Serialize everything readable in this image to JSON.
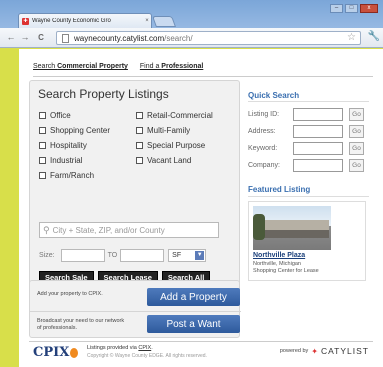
{
  "browser": {
    "tab_title": "Wayne County Economic Gro",
    "tab_close": "×",
    "url_domain": "waynecounty.catylist.com",
    "url_path": "/search/",
    "back_glyph": "←",
    "forward_glyph": "→",
    "reload_glyph": "C",
    "star_glyph": "☆",
    "menu_glyph": "🔧",
    "win_min": "–",
    "win_max": "□",
    "win_close": "x"
  },
  "topnav": {
    "link1_prefix": "Search ",
    "link1_bold": "Commercial Property",
    "link2_prefix": "Find a ",
    "link2_bold": "Professional"
  },
  "search_panel": {
    "title": "Search Property Listings",
    "checkboxes": [
      "Office",
      "Retail-Commercial",
      "Shopping Center",
      "Multi-Family",
      "Hospitality",
      "Special Purpose",
      "Industrial",
      "Vacant Land",
      "Farm/Ranch"
    ],
    "location_placeholder": "City + State, ZIP, and/or County",
    "size_label": "Size:",
    "size_to": "TO",
    "size_unit": "SF",
    "buttons": [
      "Search Sale",
      "Search Lease",
      "Search All"
    ]
  },
  "cta": {
    "add_text": "Add your property to CPIX.",
    "add_button": "Add a Property",
    "want_text": "Broadcast your need to our network of professionals.",
    "want_button": "Post a Want"
  },
  "quick_search": {
    "title": "Quick Search",
    "fields": [
      {
        "label": "Listing ID:",
        "go": "Go"
      },
      {
        "label": "Address:",
        "go": "Go"
      },
      {
        "label": "Keyword:",
        "go": "Go"
      },
      {
        "label": "Company:",
        "go": "Go"
      }
    ]
  },
  "featured": {
    "title": "Featured Listing",
    "name": "Northville Plaza",
    "location": "Northville, Michigan",
    "type": "Shopping Center for Lease"
  },
  "footer": {
    "logo": "CPIX",
    "line1_prefix": "Listings provided via ",
    "line1_link": "CPIX",
    "line1_suffix": ".",
    "line2": "Copyright © Wayne County EDGE. All rights reserved.",
    "powered_by": "powered by",
    "brand": "CATYLIST"
  }
}
